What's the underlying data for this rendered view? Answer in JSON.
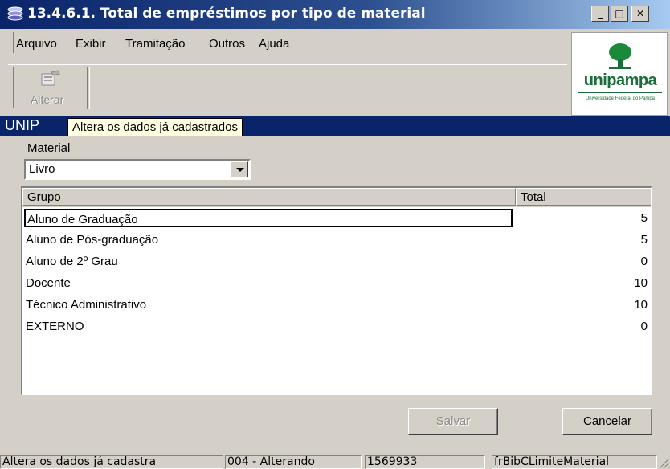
{
  "window": {
    "title": "13.4.6.1. Total de empréstimos por tipo de material"
  },
  "menu": [
    "Arquivo",
    "Exibir",
    "Tramitação",
    "Outros",
    "Ajuda"
  ],
  "toolbar": {
    "alterar_label": "Alterar"
  },
  "logo": {
    "brand": "unipampa",
    "subtitle": "Universidade Federal do Pampa"
  },
  "header_band": {
    "text": "UNIP"
  },
  "tooltip": {
    "text": "Altera os dados já cadastrados"
  },
  "form": {
    "material_label": "Material",
    "material_value": "Livro"
  },
  "grid": {
    "headers": [
      "Grupo",
      "Total"
    ],
    "rows": [
      {
        "grupo": "Aluno de Graduação",
        "total": "5"
      },
      {
        "grupo": "Aluno de Pós-graduação",
        "total": "5"
      },
      {
        "grupo": "Aluno de 2º Grau",
        "total": "0"
      },
      {
        "grupo": "Docente",
        "total": "10"
      },
      {
        "grupo": "Técnico Administrativo",
        "total": "10"
      },
      {
        "grupo": "EXTERNO",
        "total": "0"
      }
    ]
  },
  "buttons": {
    "salvar": "Salvar",
    "cancelar": "Cancelar"
  },
  "status": {
    "message": "Altera os dados já cadastra",
    "mode": "004 - Alterando",
    "code": "1569933",
    "form_name": "frBibCLimiteMaterial"
  }
}
